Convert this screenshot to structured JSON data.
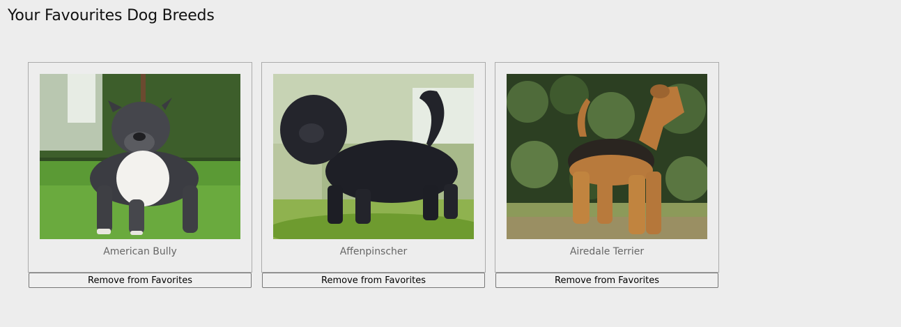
{
  "page": {
    "title": "Your Favourites Dog Breeds"
  },
  "favorites": [
    {
      "breed": "American Bully",
      "button_label": "Remove from Favorites",
      "photo_icon": "american-bully-photo"
    },
    {
      "breed": "Affenpinscher",
      "button_label": "Remove from Favorites",
      "photo_icon": "affenpinscher-photo"
    },
    {
      "breed": "Airedale Terrier",
      "button_label": "Remove from Favorites",
      "photo_icon": "airedale-terrier-photo"
    }
  ],
  "colors": {
    "background": "#ededed",
    "card_border": "#aaaaaa",
    "breed_text": "#666666",
    "button_border": "#767676"
  }
}
